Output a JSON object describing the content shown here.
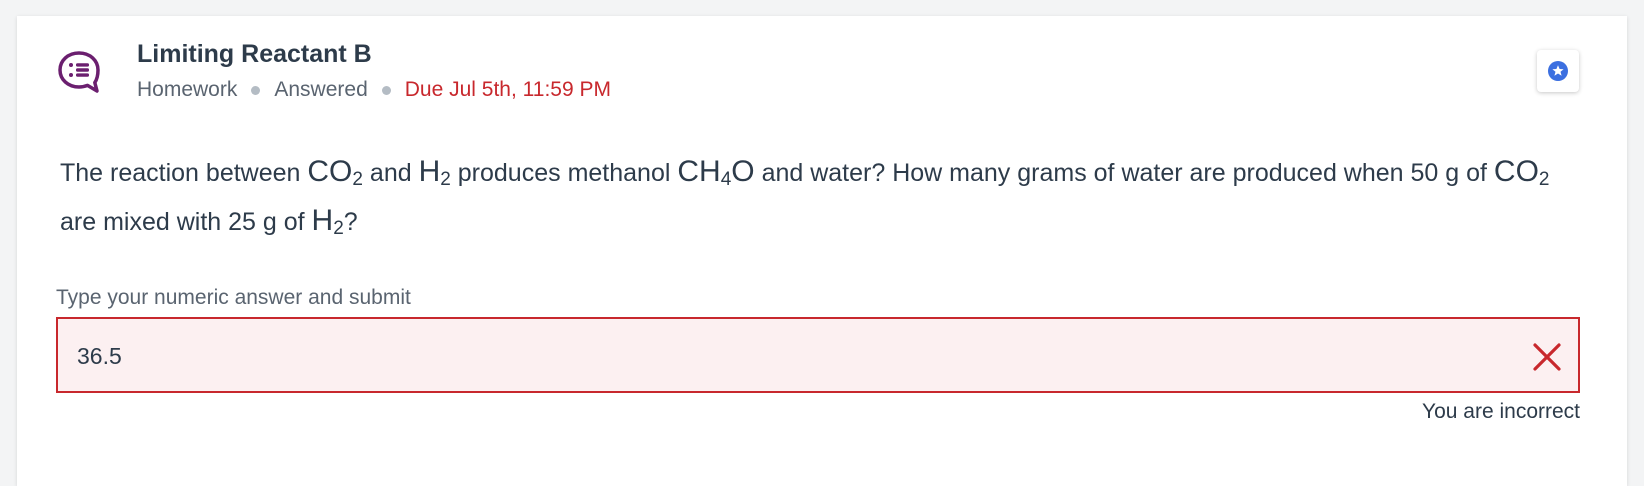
{
  "header": {
    "title": "Limiting Reactant B",
    "type": "Homework",
    "status": "Answered",
    "due": "Due Jul 5th, 11:59 PM",
    "question_icon": "question-list-icon",
    "star_icon": "star-icon"
  },
  "question": {
    "t1": "The reaction between ",
    "f1": {
      "base": "CO",
      "sub": "2"
    },
    "t2": " and ",
    "f2": {
      "base": "H",
      "sub": "2"
    },
    "t3": " produces methanol ",
    "f3": {
      "base1": "CH",
      "sub": "4",
      "base2": "O"
    },
    "t4": " and water? How many grams of water are produced when 50 g of ",
    "f4": {
      "base": "CO",
      "sub": "2"
    },
    "t5": " are mixed with 25 g of ",
    "f5": {
      "base": "H",
      "sub": "2"
    },
    "t6": "?"
  },
  "answer": {
    "prompt": "Type your numeric answer and submit",
    "value": "36.5",
    "feedback": "You are incorrect",
    "status_icon": "close-icon"
  },
  "colors": {
    "brand_purple": "#6b1f6f",
    "error_red": "#c8282d",
    "error_bg": "#fcf0f1",
    "star_blue": "#3b6fe0"
  }
}
